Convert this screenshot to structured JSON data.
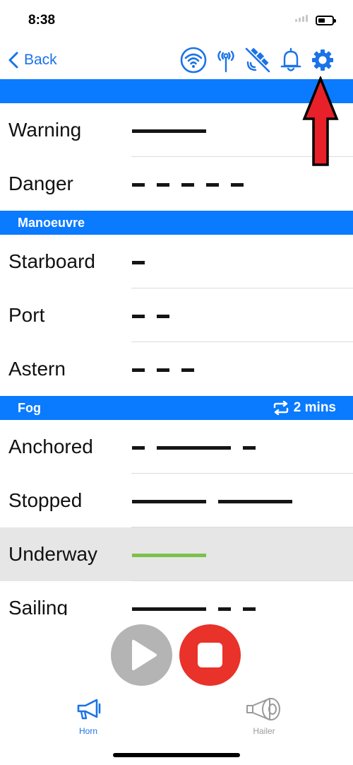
{
  "status_bar": {
    "time": "8:38",
    "battery_level": 0.5
  },
  "nav": {
    "back_label": "Back",
    "icons": [
      "wifi-icon",
      "antenna-icon",
      "satellite-off-icon",
      "bell-icon",
      "gear-icon"
    ]
  },
  "sections": [
    {
      "title": "",
      "rows": [
        {
          "label": "Warning",
          "pattern": [
            "long"
          ]
        },
        {
          "label": "Danger",
          "pattern": [
            "short",
            "short",
            "short",
            "short",
            "short"
          ]
        }
      ]
    },
    {
      "title": "Manoeuvre",
      "rows": [
        {
          "label": "Starboard",
          "pattern": [
            "short"
          ]
        },
        {
          "label": "Port",
          "pattern": [
            "short",
            "short"
          ]
        },
        {
          "label": "Astern",
          "pattern": [
            "short",
            "short",
            "short"
          ]
        }
      ]
    },
    {
      "title": "Fog",
      "repeat": "2 mins",
      "rows": [
        {
          "label": "Anchored",
          "pattern": [
            "short",
            "long",
            "short"
          ]
        },
        {
          "label": "Stopped",
          "pattern": [
            "long",
            "long"
          ]
        },
        {
          "label": "Underway",
          "pattern": [
            "long"
          ],
          "selected": true
        },
        {
          "label": "Sailing",
          "pattern": [
            "long",
            "short",
            "short"
          ]
        }
      ]
    }
  ],
  "tabs": [
    {
      "label": "Horn",
      "active": true
    },
    {
      "label": "Hailer",
      "active": false
    }
  ],
  "colors": {
    "accent": "#0a7aff",
    "link": "#1a73e8",
    "stop": "#e8322a",
    "play": "#b4b4b4",
    "selected_signal": "#7cc04a",
    "annotation_arrow": "#e8202a"
  }
}
